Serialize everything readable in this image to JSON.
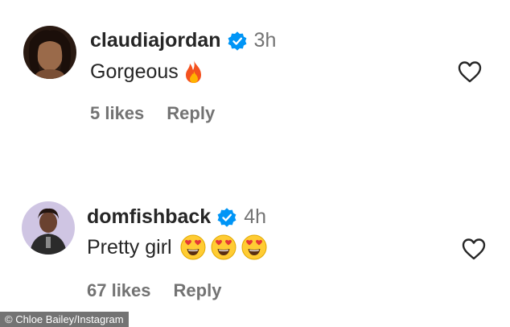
{
  "comments": [
    {
      "username": "claudiajordan",
      "time": "3h",
      "text": "Gorgeous",
      "emoji": [
        "fire-emoji"
      ],
      "likes": "5 likes",
      "reply": "Reply"
    },
    {
      "username": "domfishback",
      "time": "4h",
      "text": "Pretty girl",
      "emoji": [
        "heart-eyes-emoji",
        "heart-eyes-emoji",
        "heart-eyes-emoji"
      ],
      "likes": "67 likes",
      "reply": "Reply"
    }
  ],
  "watermark": "© Chloe Bailey/Instagram",
  "colors": {
    "verified_blue": "#0095f6",
    "text_primary": "#262626",
    "text_secondary": "#737373"
  },
  "icons": [
    "verified-badge-icon",
    "heart-outline-icon"
  ]
}
